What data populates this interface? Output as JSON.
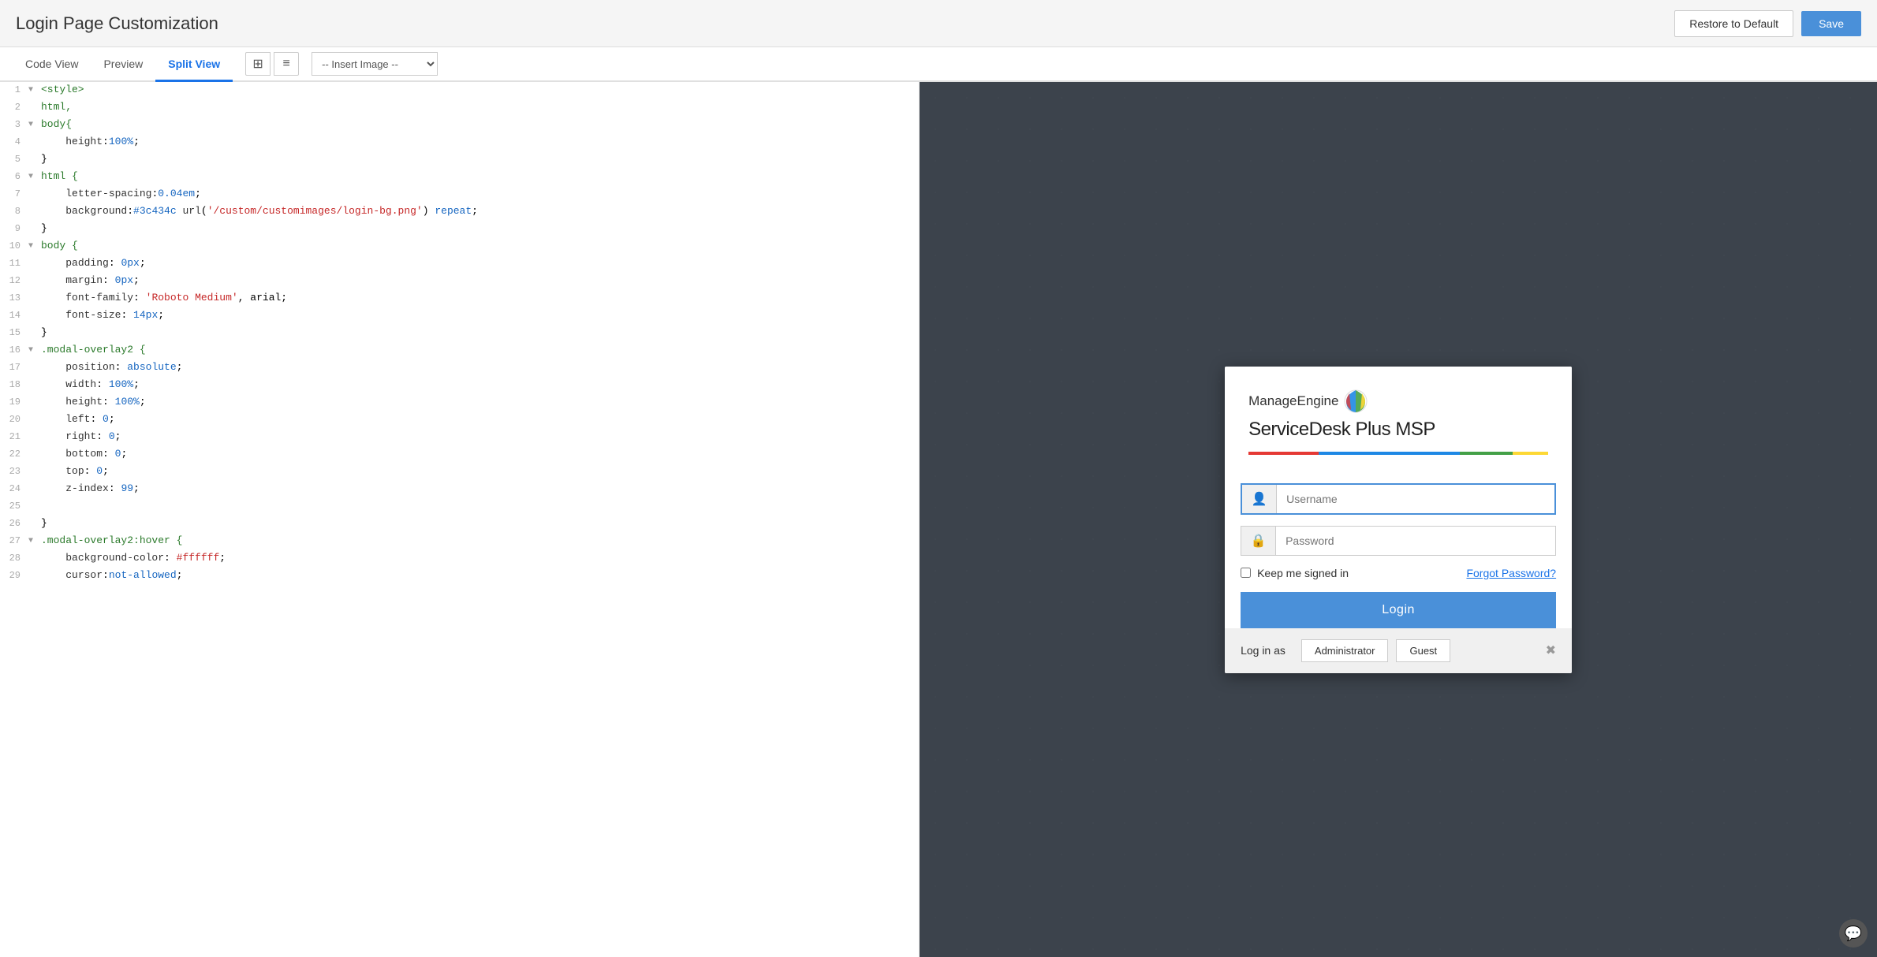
{
  "header": {
    "title": "Login Page Customization",
    "restore_label": "Restore to Default",
    "save_label": "Save"
  },
  "toolbar": {
    "tabs": [
      {
        "id": "code-view",
        "label": "Code View",
        "active": false
      },
      {
        "id": "preview",
        "label": "Preview",
        "active": false
      },
      {
        "id": "split-view",
        "label": "Split View",
        "active": true
      }
    ],
    "insert_image_placeholder": "-- Insert Image --"
  },
  "code_editor": {
    "lines": [
      {
        "num": 1,
        "toggle": "▼",
        "content": "<style>"
      },
      {
        "num": 2,
        "toggle": "",
        "content": "html,"
      },
      {
        "num": 3,
        "toggle": "▼",
        "content": "body{"
      },
      {
        "num": 4,
        "toggle": "",
        "content": "    height:100%;"
      },
      {
        "num": 5,
        "toggle": "",
        "content": "}"
      },
      {
        "num": 6,
        "toggle": "▼",
        "content": "html {"
      },
      {
        "num": 7,
        "toggle": "",
        "content": "    letter-spacing:0.04em;"
      },
      {
        "num": 8,
        "toggle": "",
        "content": "    background:#3c434c url('/custom/customimages/login-bg.png') repeat;"
      },
      {
        "num": 9,
        "toggle": "",
        "content": "}"
      },
      {
        "num": 10,
        "toggle": "▼",
        "content": "body {"
      },
      {
        "num": 11,
        "toggle": "",
        "content": "    padding: 0px;"
      },
      {
        "num": 12,
        "toggle": "",
        "content": "    margin: 0px;"
      },
      {
        "num": 13,
        "toggle": "",
        "content": "    font-family: 'Roboto Medium', arial;"
      },
      {
        "num": 14,
        "toggle": "",
        "content": "    font-size: 14px;"
      },
      {
        "num": 15,
        "toggle": "",
        "content": "}"
      },
      {
        "num": 16,
        "toggle": "▼",
        "content": ".modal-overlay2 {"
      },
      {
        "num": 17,
        "toggle": "",
        "content": "    position: absolute;"
      },
      {
        "num": 18,
        "toggle": "",
        "content": "    width: 100%;"
      },
      {
        "num": 19,
        "toggle": "",
        "content": "    height: 100%;"
      },
      {
        "num": 20,
        "toggle": "",
        "content": "    left: 0;"
      },
      {
        "num": 21,
        "toggle": "",
        "content": "    right: 0;"
      },
      {
        "num": 22,
        "toggle": "",
        "content": "    bottom: 0;"
      },
      {
        "num": 23,
        "toggle": "",
        "content": "    top: 0;"
      },
      {
        "num": 24,
        "toggle": "",
        "content": "    z-index: 99;"
      },
      {
        "num": 25,
        "toggle": "",
        "content": ""
      },
      {
        "num": 26,
        "toggle": "",
        "content": "}"
      },
      {
        "num": 27,
        "toggle": "▼",
        "content": ".modal-overlay2:hover {"
      },
      {
        "num": 28,
        "toggle": "",
        "content": "    background-color: #ffffff;"
      },
      {
        "num": 29,
        "toggle": "",
        "content": "    cursor:not-allowed;"
      }
    ]
  },
  "preview": {
    "brand": {
      "name": "ManageEngine",
      "product": "ServiceDesk",
      "product_suffix": " Plus MSP"
    },
    "form": {
      "username_placeholder": "Username",
      "password_placeholder": "Password",
      "keep_signed_label": "Keep me signed in",
      "forgot_password_label": "Forgot Password?",
      "login_label": "Login"
    },
    "bottom": {
      "log_in_as_label": "Log in as",
      "roles": [
        "Administrator",
        "Guest"
      ]
    }
  }
}
